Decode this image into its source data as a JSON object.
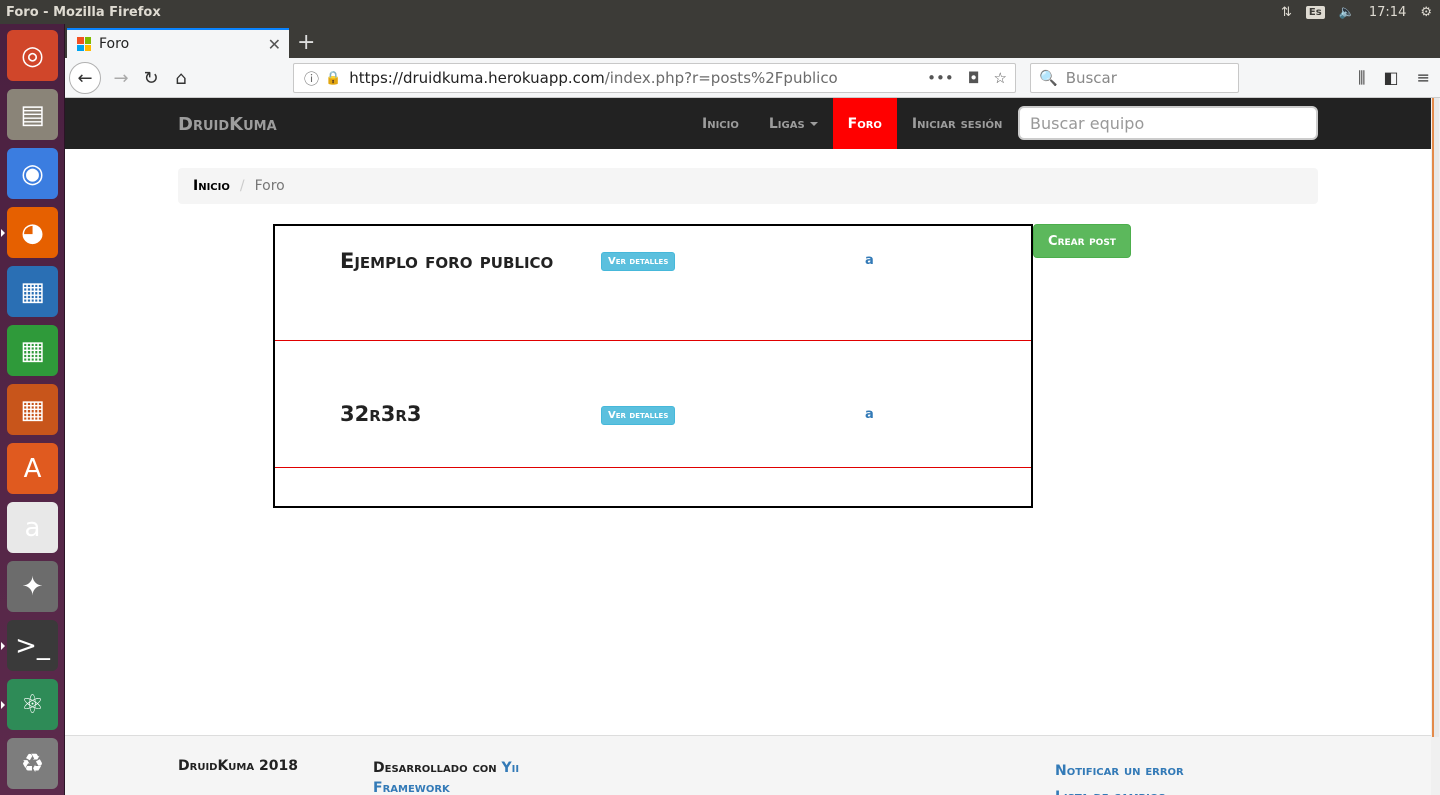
{
  "window": {
    "title": "Foro - Mozilla Firefox",
    "keyboard": "Es",
    "clock": "17:14"
  },
  "launcher": {
    "apps": [
      {
        "name": "ubuntu-dash",
        "glyph": "◎",
        "color": "#d0462a"
      },
      {
        "name": "files",
        "glyph": "▤",
        "color": "#8a8478"
      },
      {
        "name": "chrome",
        "glyph": "◉",
        "color": "#3b7de0"
      },
      {
        "name": "firefox",
        "glyph": "◕",
        "color": "#e66000"
      },
      {
        "name": "writer",
        "glyph": "▦",
        "color": "#2a6fb4"
      },
      {
        "name": "calc",
        "glyph": "▦",
        "color": "#2f9a3a"
      },
      {
        "name": "impress",
        "glyph": "▦",
        "color": "#c8551b"
      },
      {
        "name": "software-center",
        "glyph": "A",
        "color": "#e05a1f"
      },
      {
        "name": "amazon",
        "glyph": "a",
        "color": "#e8e8e8"
      },
      {
        "name": "system-settings",
        "glyph": "✦",
        "color": "#6c6c6c"
      },
      {
        "name": "terminal",
        "glyph": ">_",
        "color": "#3a3a3a"
      },
      {
        "name": "atom",
        "glyph": "⚛",
        "color": "#2e8b57"
      },
      {
        "name": "trash",
        "glyph": "♻",
        "color": "#7d7d7d"
      }
    ]
  },
  "browser": {
    "tab_title": "Foro",
    "url_host": "https://druidkuma.herokuapp.com",
    "url_path": "/index.php?r=posts%2Fpublico",
    "search_placeholder": "Buscar"
  },
  "site": {
    "brand": "DruidKuma",
    "menu": {
      "home": "Inicio",
      "leagues": "Ligas",
      "forum": "Foro",
      "login": "Iniciar sesión"
    },
    "team_search_placeholder": "Buscar equipo",
    "breadcrumb": {
      "home": "Inicio",
      "current": "Foro"
    },
    "posts": [
      {
        "title": "Ejemplo foro publico",
        "details_label": "Ver detalles",
        "link": "a"
      },
      {
        "title": "32r3r3",
        "details_label": "Ver detalles",
        "link": "a"
      }
    ],
    "create_post_label": "Crear post",
    "footer": {
      "copyright": "DruidKuma 2018",
      "dev_prefix": "Desarrollado con",
      "dev_link": "Yii Framework",
      "report_error": "Notificar un error",
      "changes_list": "Lista de cambios"
    }
  }
}
